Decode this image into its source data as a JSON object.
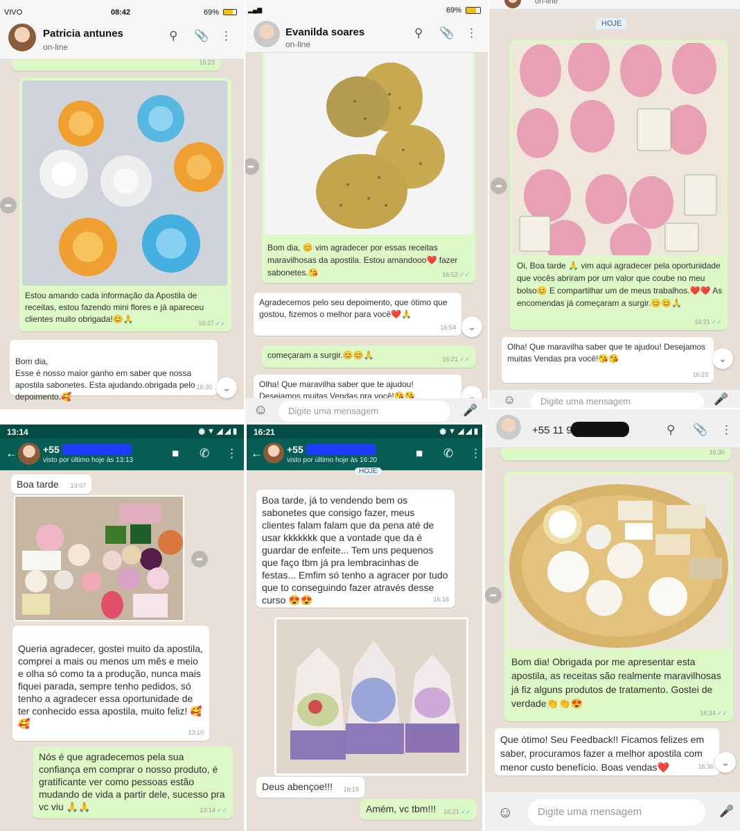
{
  "p1": {
    "status": {
      "carrier": "VIVO",
      "time": "08:42",
      "battery": "69%"
    },
    "contact": {
      "name": "Patricia antunes",
      "status": "on-line"
    },
    "msgs": [
      {
        "time": "16:23"
      },
      {
        "text": "Estou amando cada informação da Apostila de receitas, estou fazendo mini flores e já apareceu clientes muito obrigada!😊🙏",
        "time": "16:27"
      },
      {
        "text": "Bom dia,\nEsse é nosso maior ganho em saber que nossa apostila sabonetes. Esta ajudando.obrigada pelo depoimento.🥰",
        "time": "16:30"
      }
    ]
  },
  "p2": {
    "status": {
      "battery": "69%"
    },
    "contact": {
      "name": "Evanilda soares",
      "status": "on-line"
    },
    "msgs": [
      {
        "text": "Bom dia, 😊 vim agradecer por essas receitas maravilhosas da apostila. Estou amandooo❤️ fazer sabonetes.😘",
        "time": "16:52"
      },
      {
        "text": "Agradecemos pelo seu depoimento, que ótimo que gostou, fizemos o melhor para você❤️🙏",
        "time": "16:54"
      },
      {
        "text": "começaram a surgir.😊😊🙏",
        "time": "16:21"
      },
      {
        "text": "Olha! Que maravilha saber que te ajudou! Desejamos muitas Vendas pra você!😘😘"
      }
    ],
    "input_placeholder": "Digite uma mensagem"
  },
  "p3": {
    "header": {
      "status": "on-line"
    },
    "date": "HOJE",
    "msgs": [
      {
        "text": "Oi, Boa tarde 🙏 vim aqui agradecer pela oportunidade que vocês abriram por um valor que coube no meu bolso😊 E compartilhar um de meus trabalhos.❤️❤️ As encomendas já começaram a surgir.😊😊🙏",
        "time": "16:21"
      },
      {
        "text": "Olha! Que maravilha saber que te ajudou! Desejamos muitas Vendas pra você!😘😘",
        "time": "16:23"
      }
    ],
    "input_placeholder": "Digite uma mensagem"
  },
  "p4": {
    "status": {
      "time": "13:14"
    },
    "contact": {
      "name": "+55",
      "status": "visto por último hoje às 13:13"
    },
    "msgs": [
      {
        "text": "Boa tarde",
        "time": "13:07"
      },
      {
        "text": "Queria agradecer, gostei muito da apostila, comprei a mais ou menos um mês e meio e olha só como ta a produção, nunca mais fiquei parada, sempre tenho pedidos, só tenho a agradecer essa oportunidade de ter conhecido essa apostila, muito feliz! 🥰\n🥰",
        "time": "13:10"
      },
      {
        "text": "Nós é que agradecemos pela sua confiança em comprar o nosso produto, é gratificante ver como pessoas estão mudando de vida a partir dele, sucesso pra vc viu 🙏🙏",
        "time": "13:14"
      }
    ]
  },
  "p5": {
    "status": {
      "time": "16:21"
    },
    "contact": {
      "name": "+55",
      "status": "visto por último hoje às 16:20"
    },
    "date": "HOJE",
    "msgs": [
      {
        "text": "Boa tarde, já to vendendo bem os sabonetes que consigo fazer, meus clientes falam falam que da pena até de usar kkkkkkk que a vontade que da é guardar de enfeite... Tem uns pequenos que faço tbm já pra lembracinhas de festas... Emfim só tenho a agracer por tudo que to conseguindo fazer através desse curso 😍😍",
        "time": "16:16"
      },
      {
        "text": "Deus abençoe!!!",
        "time": "16:19"
      },
      {
        "text": "Amém, vc tbm!!!",
        "time": "16:21"
      }
    ]
  },
  "p6": {
    "contact": {
      "name": "+55 11 9"
    },
    "msgs": [
      {
        "time": "16:30"
      },
      {
        "text": "Bom dia! Obrigada por me apresentar esta apostila, as receitas são realmente maravilhosas já fiz alguns produtos de tratamento. Gostei de verdade👏👏😍",
        "time": "16:34"
      },
      {
        "text": "Que ótimo! Seu Feedback!! Ficamos felizes em saber, procuramos fazer a melhor apostila com menor custo benefício. Boas vendas❤️",
        "time": "16:36"
      }
    ],
    "input_placeholder": "Digite uma mensagem"
  },
  "icons": [
    "search-icon",
    "attach-icon",
    "menu-icon",
    "forward-icon",
    "chevron-down-icon",
    "emoji-icon",
    "mic-icon",
    "video-icon",
    "phone-icon",
    "back-icon"
  ],
  "colors": {
    "outgoing": "#dcf8c6",
    "incoming": "#ffffff",
    "header_green": "#075e54",
    "wallpaper": "#e8e0d7"
  }
}
